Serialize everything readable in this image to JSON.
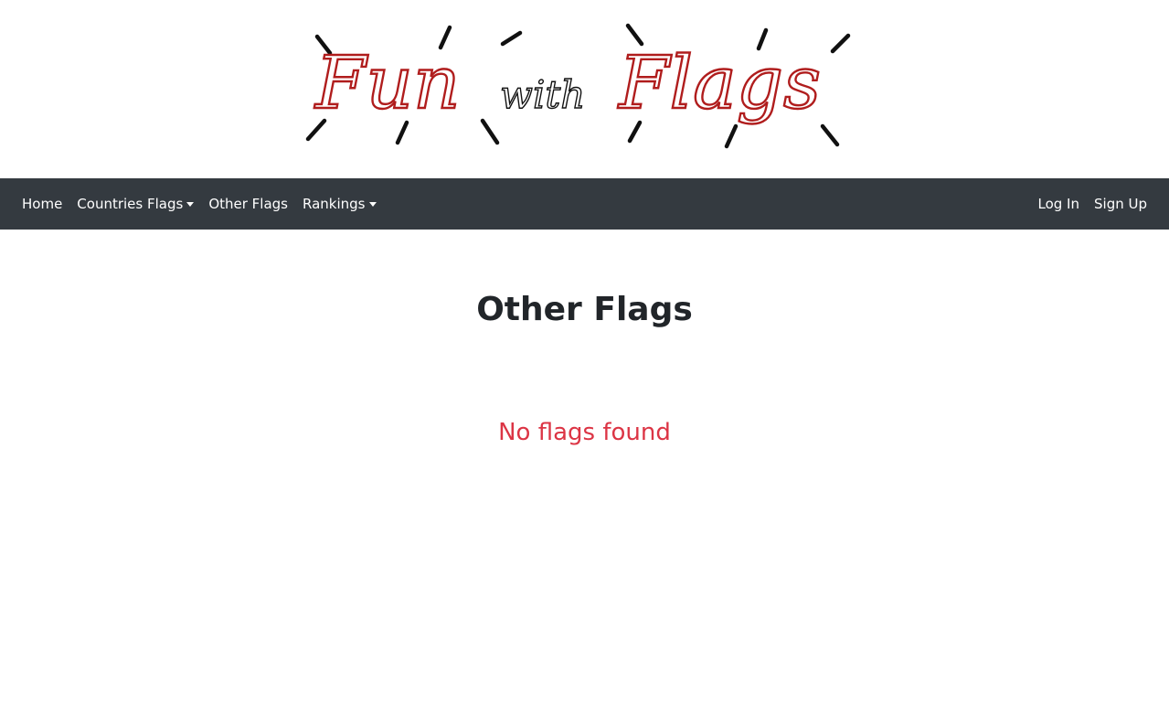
{
  "logo": {
    "word1": "Fun",
    "word2": "with",
    "word3": "Flags",
    "colors": {
      "script": "#b01d1d",
      "rays": "#111111"
    }
  },
  "navbar": {
    "background": "#343a40",
    "left_items": [
      {
        "label": "Home",
        "dropdown": false
      },
      {
        "label": "Countries Flags",
        "dropdown": true
      },
      {
        "label": "Other Flags",
        "dropdown": false
      },
      {
        "label": "Rankings",
        "dropdown": true
      }
    ],
    "right_items": [
      {
        "label": "Log In"
      },
      {
        "label": "Sign Up"
      }
    ]
  },
  "main": {
    "title": "Other Flags",
    "empty_message": "No flags found",
    "empty_color": "#dc3545"
  }
}
